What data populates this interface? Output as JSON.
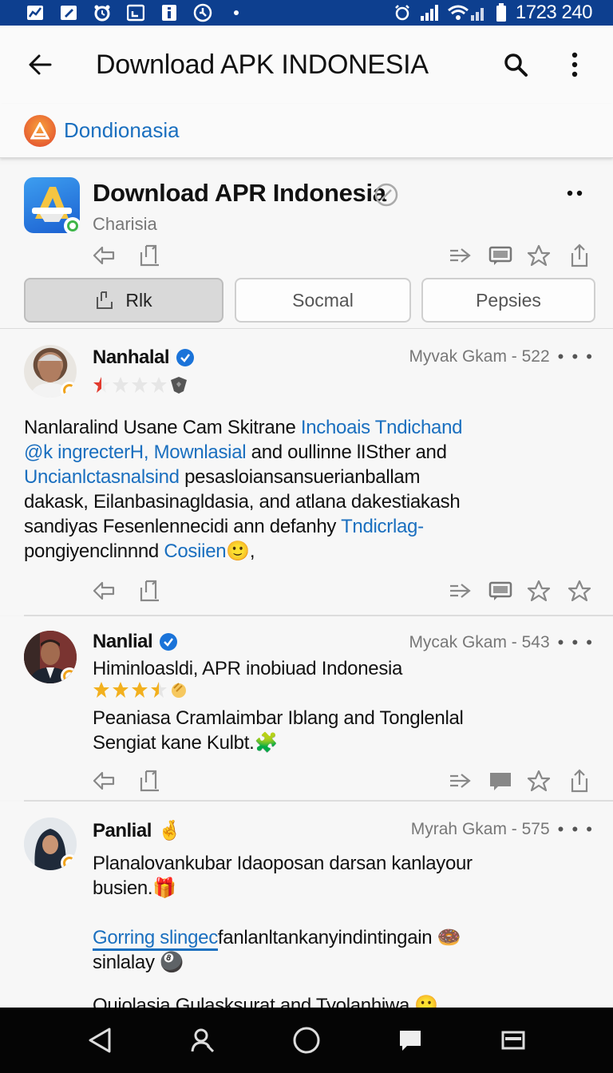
{
  "status_bar": {
    "time": "1723 240",
    "icons": [
      "chart-app-icon",
      "edit-app-icon",
      "alarm-app-icon",
      "calendar-app-icon",
      "info-app-icon",
      "settings-app-icon",
      "dot-icon",
      "alarm-icon",
      "signal-icon",
      "wifi-icon",
      "battery-icon"
    ]
  },
  "app_bar": {
    "title": "Download APK INDONESIA",
    "icons": [
      "back-arrow-icon",
      "search-icon",
      "more-vert-icon"
    ]
  },
  "source": {
    "name": "Dondionasia",
    "logo_color": "#e85a2e"
  },
  "app_card": {
    "title": "Download APR Indonesia",
    "subtitle": "Charisia",
    "tabs": [
      {
        "label": "Rlk",
        "active": true
      },
      {
        "label": "Socmal",
        "active": false
      },
      {
        "label": "Pepsies",
        "active": false
      }
    ]
  },
  "posts": [
    {
      "author": "Nanhalal",
      "verified": true,
      "meta": "Myvak Gkam - 522",
      "rating": 1,
      "text_lines": [
        [
          {
            "t": "Nanlaralind Usane Cam Skitrane "
          },
          {
            "t": "Inchoais Tndichand",
            "link": true
          }
        ],
        [
          {
            "t": "@k ingrecterH, Mownlasial",
            "link": true
          },
          {
            "t": " and oullinne lISther and"
          }
        ],
        [
          {
            "t": "Uncianlctasnalsind",
            "link": true
          },
          {
            "t": " pesasloiansansuerianballam"
          }
        ],
        [
          {
            "t": "dakask, Eilanbasinagldasia, and atlana dakestiakash"
          }
        ],
        [
          {
            "t": "sandiyas Fesenlennecidi ann defanhy "
          },
          {
            "t": "Tndicrlag-",
            "link": true
          }
        ],
        [
          {
            "t": "pongiyenclinnnd "
          },
          {
            "t": "Cosiien",
            "link": true
          },
          {
            "t": "🙂,"
          }
        ]
      ]
    },
    {
      "author": "Nanlial",
      "verified": true,
      "meta": "Mycak Gkam - 543",
      "headline": "Himinloasldi, APR inobiuad Indonesia",
      "rating": 3.5,
      "text_lines": [
        [
          {
            "t": "Peaniasa Cramlaimbar Iblang and Tonglenlal"
          }
        ],
        [
          {
            "t": "Sengiat kane Kulbt.🧩"
          }
        ]
      ]
    },
    {
      "author": "Panlial",
      "verified": false,
      "emoji": "🤞",
      "meta": "Myrah Gkam - 575",
      "text_lines": [
        [
          {
            "t": "Planalovankubar Idaoposan darsan kanlayour"
          }
        ],
        [
          {
            "t": "busien.🎁"
          }
        ],
        [
          {
            "t": ""
          }
        ],
        [
          {
            "t": "Gorring slingec",
            "link": true
          },
          {
            "t": "fanlanltankanyindintingain 🍩"
          }
        ],
        [
          {
            "t": "sinlalay 🎱"
          }
        ]
      ],
      "cut_line": "Quiolasia Gulasksurat and Tyolanhiwa 🙂"
    }
  ],
  "nav_bar": {
    "icons": [
      "back-triangle-icon",
      "user-search-icon",
      "home-circle-icon",
      "chat-icon",
      "recents-icon"
    ]
  }
}
